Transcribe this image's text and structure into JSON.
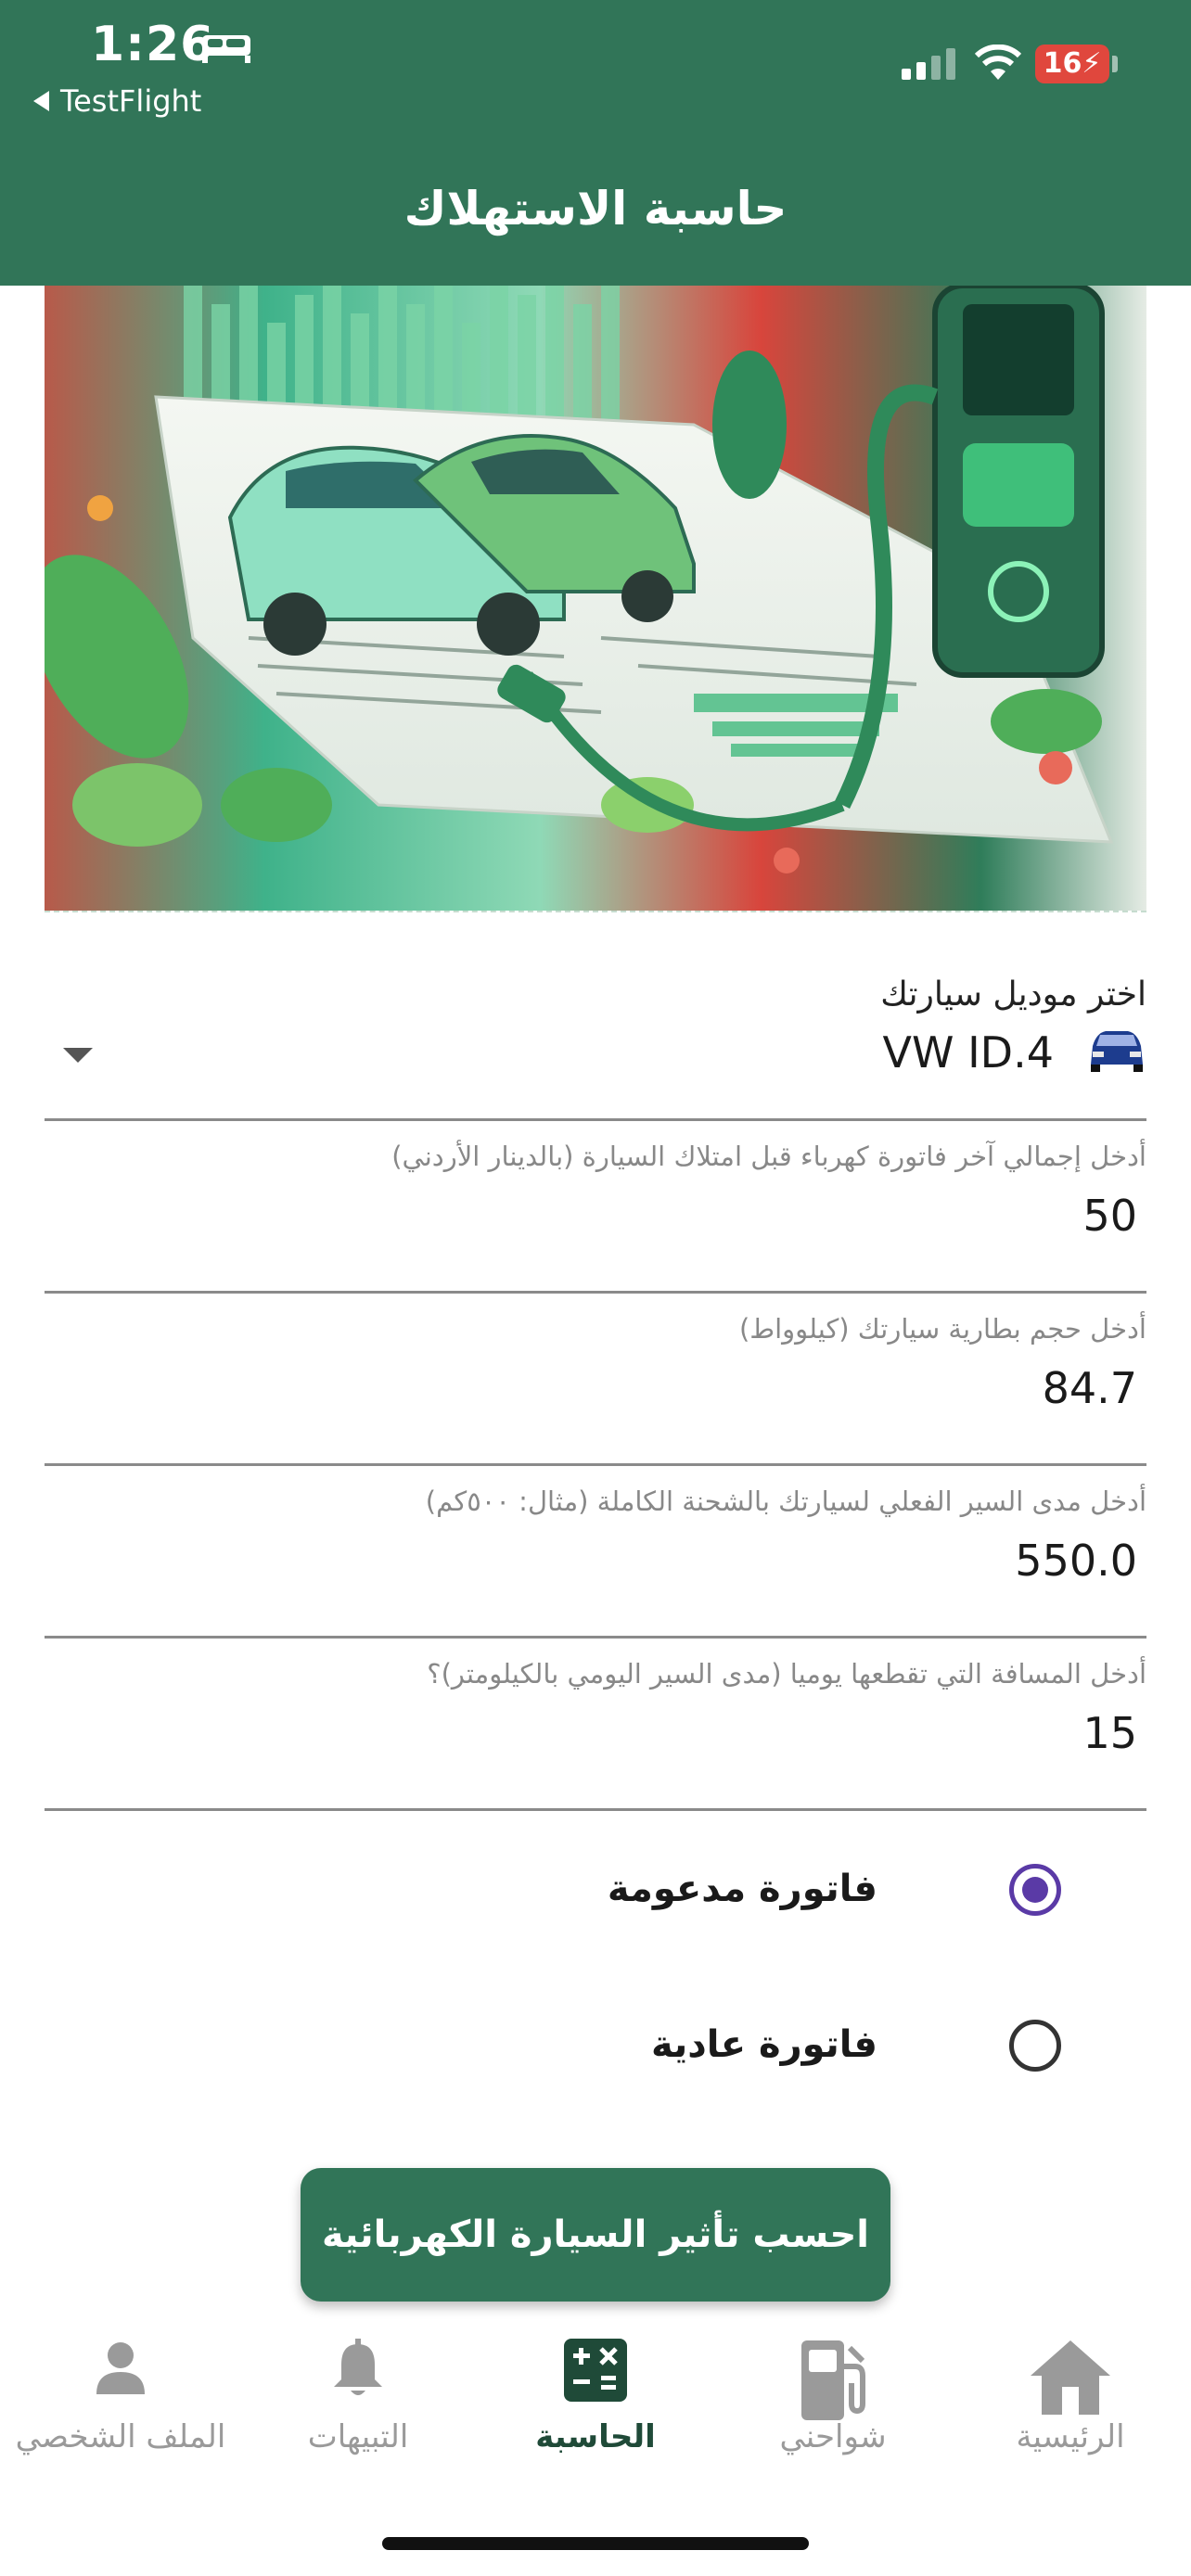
{
  "status_bar": {
    "time": "1:26",
    "back_label": "TestFlight",
    "battery": "16"
  },
  "header": {
    "title": "حاسبة الاستهلاك"
  },
  "hero": {
    "icon": "ev-charging-illustration"
  },
  "model_select": {
    "label": "اختر موديل سيارتك",
    "value": "VW ID.4",
    "icon": "car-icon"
  },
  "fields": [
    {
      "label": "أدخل إجمالي آخر فاتورة كهرباء قبل امتلاك السيارة (بالدينار الأردني)",
      "value": "50"
    },
    {
      "label": "أدخل حجم بطارية سيارتك (كيلوواط)",
      "value": "84.7"
    },
    {
      "label": "أدخل مدى السير الفعلي لسيارتك بالشحنة الكاملة (مثال: ٥٠٠كم)",
      "value": "550.0"
    },
    {
      "label": "أدخل المسافة التي تقطعها يوميا (مدى السير اليومي بالكيلومتر)؟",
      "value": "15"
    }
  ],
  "bill_type": {
    "options": [
      {
        "label": "فاتورة مدعومة",
        "selected": true
      },
      {
        "label": "فاتورة عادية",
        "selected": false
      }
    ]
  },
  "action": {
    "label": "احسب تأثير السيارة الكهربائية"
  },
  "nav": {
    "items": [
      {
        "label": "الملف الشخصي",
        "icon": "person-icon"
      },
      {
        "label": "التبيهات",
        "icon": "bell-icon"
      },
      {
        "label": "الحاسبة",
        "icon": "calculator-icon",
        "active": true
      },
      {
        "label": "شواحني",
        "icon": "fuel-pump-icon"
      },
      {
        "label": "الرئيسية",
        "icon": "home-icon"
      }
    ]
  },
  "colors": {
    "brand_green": "#317558",
    "radio_purple": "#5a3aa6"
  }
}
